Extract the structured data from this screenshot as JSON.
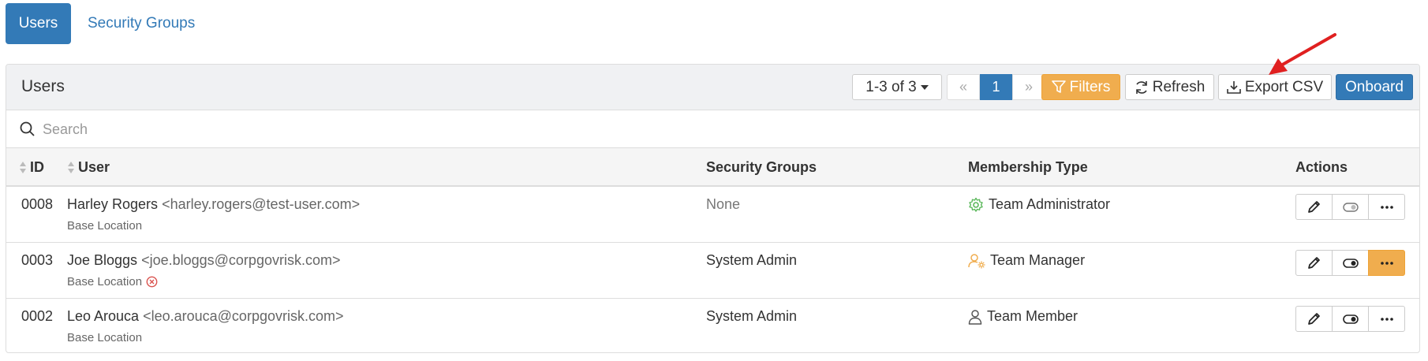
{
  "tabs": [
    {
      "label": "Users",
      "active": true
    },
    {
      "label": "Security Groups",
      "active": false
    }
  ],
  "panel": {
    "title": "Users",
    "range_dropdown": "1-3 of 3",
    "pagination": {
      "first": "«",
      "current": "1",
      "last": "»"
    },
    "buttons": {
      "filters": "Filters",
      "refresh": "Refresh",
      "export": "Export CSV",
      "onboard": "Onboard"
    },
    "search_placeholder": "Search"
  },
  "columns": {
    "id": "ID",
    "user": "User",
    "security_groups": "Security Groups",
    "membership_type": "Membership Type",
    "actions": "Actions"
  },
  "rows": [
    {
      "id": "0008",
      "name": "Harley Rogers",
      "email": "<harley.rogers@test-user.com>",
      "location": "Base Location",
      "location_error": false,
      "security_groups": "None",
      "membership": "Team Administrator",
      "membership_icon": "gear-icon",
      "more_highlighted": false,
      "toggle_on": false
    },
    {
      "id": "0003",
      "name": "Joe Bloggs",
      "email": "<joe.bloggs@corpgovrisk.com>",
      "location": "Base Location",
      "location_error": true,
      "security_groups": "System Admin",
      "membership": "Team Manager",
      "membership_icon": "user-gear-icon",
      "more_highlighted": true,
      "toggle_on": true
    },
    {
      "id": "0002",
      "name": "Leo Arouca",
      "email": "<leo.arouca@corpgovrisk.com>",
      "location": "Base Location",
      "location_error": false,
      "security_groups": "System Admin",
      "membership": "Team Member",
      "membership_icon": "user-icon",
      "more_highlighted": false,
      "toggle_on": true
    }
  ],
  "colors": {
    "primary": "#337ab7",
    "warning": "#f0ad4e",
    "success": "#5cb85c",
    "danger": "#d9534f",
    "annotation_arrow": "#e02020"
  }
}
